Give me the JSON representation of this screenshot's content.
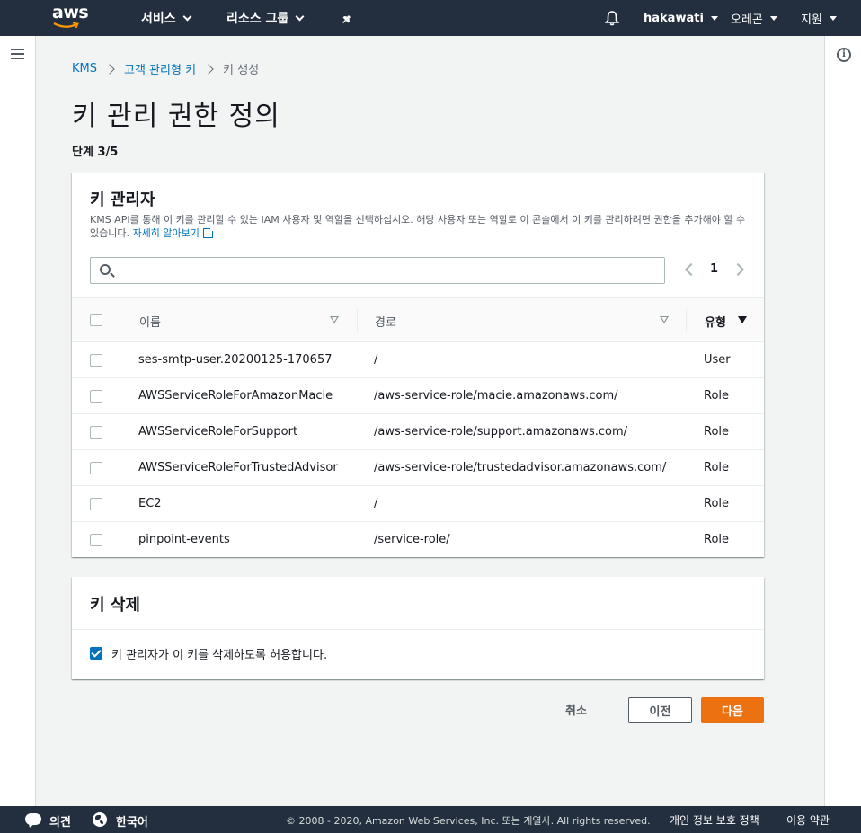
{
  "nav": {
    "logo_text": "aws",
    "services": "서비스",
    "resource_groups": "리소스 그룹",
    "account": "hakawati",
    "region": "오레곤",
    "support": "지원"
  },
  "breadcrumb": {
    "items": [
      "KMS",
      "고객 관리형 키",
      "키 생성"
    ]
  },
  "page": {
    "title": "키 관리 권한 정의",
    "step": "단계 3/5"
  },
  "admins": {
    "title": "키 관리자",
    "description": "KMS API를 통해 이 키를 관리할 수 있는 IAM 사용자 및 역할을 선택하십시오. 해당 사용자 또는 역할로 이 콘솔에서 이 키를 관리하려면 권한을 추가해야 할 수 있습니다.",
    "learn_more": "자세히 알아보기",
    "search_value": "",
    "page_number": "1",
    "columns": [
      "이름",
      "경로",
      "유형"
    ],
    "rows": [
      {
        "name": "ses-smtp-user.20200125-170657",
        "path": "/",
        "type": "User",
        "checked": false
      },
      {
        "name": "AWSServiceRoleForAmazonMacie",
        "path": "/aws-service-role/macie.amazonaws.com/",
        "type": "Role",
        "checked": false
      },
      {
        "name": "AWSServiceRoleForSupport",
        "path": "/aws-service-role/support.amazonaws.com/",
        "type": "Role",
        "checked": false
      },
      {
        "name": "AWSServiceRoleForTrustedAdvisor",
        "path": "/aws-service-role/trustedadvisor.amazonaws.com/",
        "type": "Role",
        "checked": false
      },
      {
        "name": "EC2",
        "path": "/",
        "type": "Role",
        "checked": false
      },
      {
        "name": "pinpoint-events",
        "path": "/service-role/",
        "type": "Role",
        "checked": false
      }
    ]
  },
  "deletion": {
    "title": "키 삭제",
    "checkbox_label": "키 관리자가 이 키를 삭제하도록 허용합니다.",
    "checked": true
  },
  "actions": {
    "cancel": "취소",
    "previous": "이전",
    "next": "다음"
  },
  "footer": {
    "feedback": "의견",
    "language": "한국어",
    "copyright": "© 2008 - 2020, Amazon Web Services, Inc. 또는 계열사. All rights reserved.",
    "privacy": "개인 정보 보호 정책",
    "terms": "이용 약관"
  },
  "colors": {
    "nav_bg": "#232f3e",
    "link": "#0073bb",
    "primary_button": "#ec7211"
  }
}
